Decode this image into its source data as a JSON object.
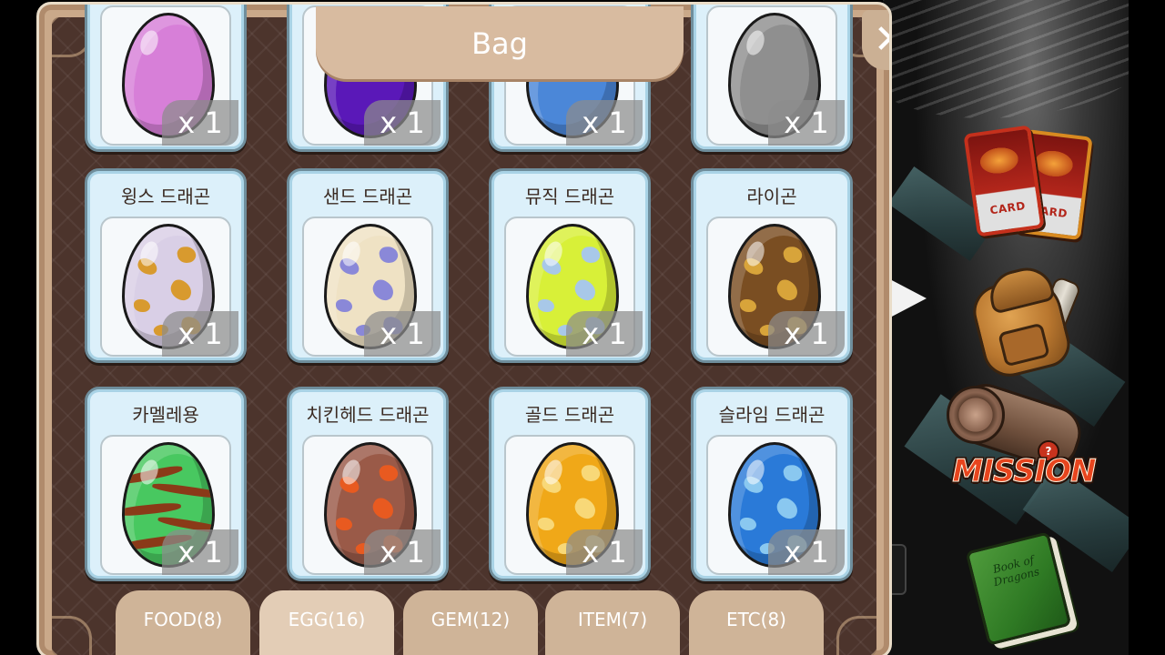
{
  "panel": {
    "title": "Bag",
    "close_label": "✕"
  },
  "eggs": [
    {
      "name": "",
      "count": "x 1",
      "color": "#d77fd8",
      "spots": "none",
      "partial": true
    },
    {
      "name": "",
      "count": "x 1",
      "color": "#5a18b8",
      "spots": "none",
      "partial": true
    },
    {
      "name": "",
      "count": "x 1",
      "color": "#4b87d8",
      "spots": "none",
      "partial": true
    },
    {
      "name": "",
      "count": "x 1",
      "color": "#8f8f8f",
      "spots": "none",
      "partial": true
    },
    {
      "name": "윙스 드래곤",
      "count": "x 1",
      "color": "#d9cfe6",
      "spot_color": "#d89a2e"
    },
    {
      "name": "샌드 드래곤",
      "count": "x 1",
      "color": "#efe2c4",
      "spot_color": "#8a88d8"
    },
    {
      "name": "뮤직 드래곤",
      "count": "x 1",
      "color": "#d8f038",
      "spot_color": "#a8c8e8"
    },
    {
      "name": "라이곤",
      "count": "x 1",
      "color": "#7a4e22",
      "spot_color": "#d8a43a"
    },
    {
      "name": "카멜레용",
      "count": "x 1",
      "color": "#48c860",
      "spot_color": "#8a3a18"
    },
    {
      "name": "치킨헤드 드래곤",
      "count": "x 1",
      "color": "#9a5a48",
      "spot_color": "#e85a20"
    },
    {
      "name": "골드 드래곤",
      "count": "x 1",
      "color": "#f0a818",
      "spot_color": "#f8d878"
    },
    {
      "name": "슬라임 드래곤",
      "count": "x 1",
      "color": "#2a7ad8",
      "spot_color": "#8ac8f0"
    }
  ],
  "tabs": [
    {
      "label": "FOOD(8)",
      "active": false
    },
    {
      "label": "EGG(16)",
      "active": true
    },
    {
      "label": "GEM(12)",
      "active": false
    },
    {
      "label": "ITEM(7)",
      "active": false
    },
    {
      "label": "ETC(8)",
      "active": false
    }
  ],
  "side_menu": {
    "card_label": "CARD",
    "mission_label": "MISSION",
    "book_label": "Book of Dragons",
    "icons": [
      "card-icon",
      "bag-icon",
      "mission-icon",
      "book-icon"
    ]
  }
}
